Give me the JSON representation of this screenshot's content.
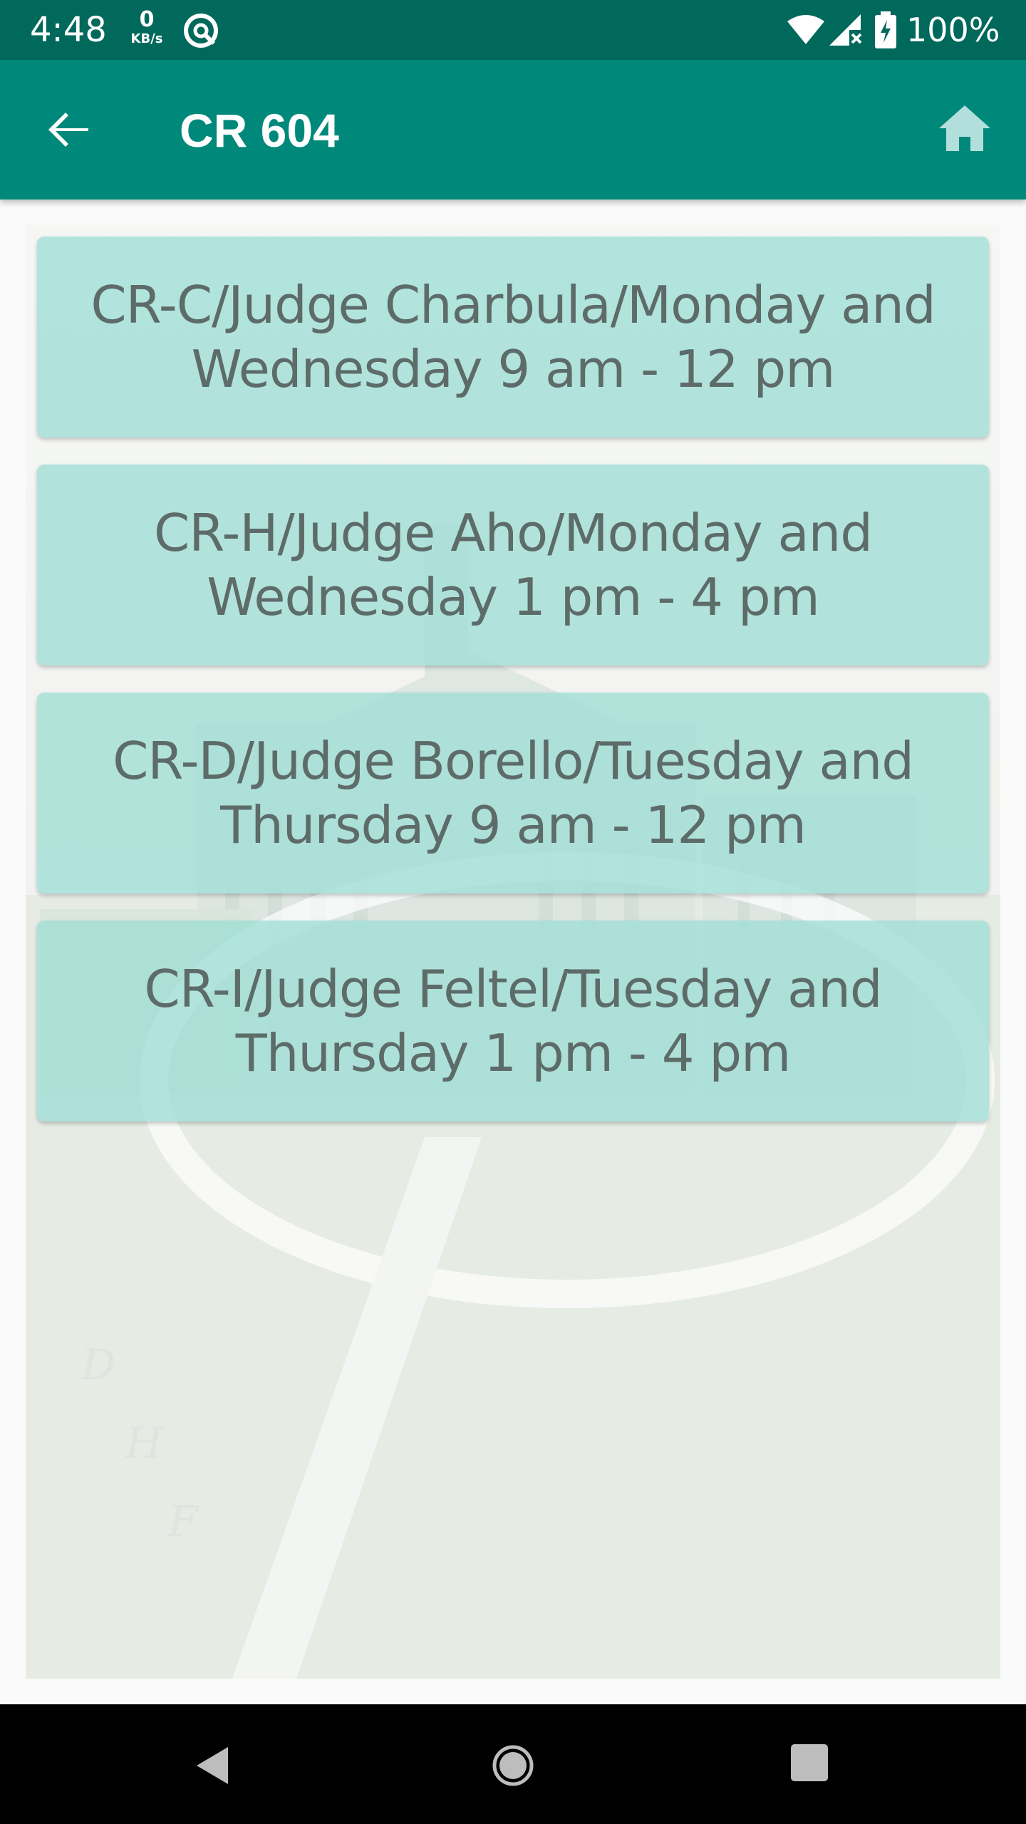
{
  "status_bar": {
    "time": "4:48",
    "net_speed_value": "0",
    "net_speed_unit": "KB/s",
    "battery_percent": "100%",
    "icons": [
      "app-notification-icon",
      "wifi-icon",
      "cell-signal-icon",
      "battery-charging-icon"
    ]
  },
  "app_bar": {
    "title": "CR 604",
    "back_icon": "arrow-back-icon",
    "home_icon": "home-icon",
    "color": "#00897b"
  },
  "schedules": [
    {
      "label": "CR-C/Judge Charbula/Monday and Wednesday 9 am - 12 pm"
    },
    {
      "label": "CR-H/Judge Aho/Monday and Wednesday 1 pm - 4 pm"
    },
    {
      "label": "CR-D/Judge Borello/Tuesday and Thursday 9 am - 12 pm"
    },
    {
      "label": "CR-I/Judge Feltel/Tuesday and Thursday 1 pm - 4 pm"
    }
  ],
  "colors": {
    "status_bar": "#00695c",
    "card": "#a0ded6",
    "card_text": "#5d6b69"
  },
  "nav_bar": {
    "icons": [
      "nav-back-icon",
      "nav-home-icon",
      "nav-recents-icon"
    ]
  }
}
